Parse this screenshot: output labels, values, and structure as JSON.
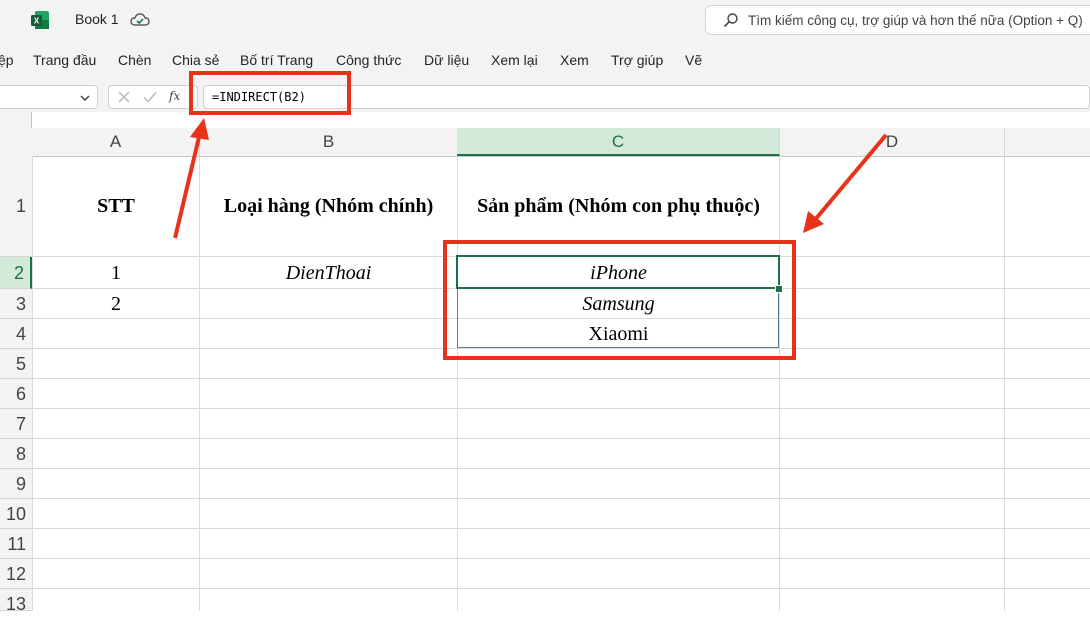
{
  "app": {
    "doc_title": "Book 1",
    "search_placeholder": "Tìm kiếm công cụ, trợ giúp và hơn thế nữa (Option + Q)"
  },
  "ribbon": {
    "tabs": [
      "ệp",
      "Trang đầu",
      "Chèn",
      "Chia sẻ",
      "Bố trí Trang",
      "Công thức",
      "Dữ liệu",
      "Xem lại",
      "Xem",
      "Trợ giúp",
      "Vẽ"
    ]
  },
  "formula_bar": {
    "name_box": "",
    "fx_label": "fx",
    "formula": "=INDIRECT(B2)"
  },
  "grid": {
    "columns": [
      "A",
      "B",
      "C",
      "D"
    ],
    "rows": [
      "1",
      "2",
      "3",
      "4",
      "5",
      "6",
      "7",
      "8",
      "9",
      "10",
      "11",
      "12",
      "13"
    ],
    "cells": {
      "A1": "STT",
      "B1": "Loại hàng (Nhóm chính)",
      "C1": "Sản phẩm (Nhóm con phụ thuộc)",
      "A2": "1",
      "B2": "DienThoai",
      "C2": "iPhone",
      "A3": "2",
      "C3": "Samsung",
      "C4": "Xiaomi"
    },
    "selected_cell": "C2"
  },
  "colors": {
    "annotation_red": "#e8321a",
    "selection_green": "#1e7145",
    "excel_green": "#107c41"
  }
}
